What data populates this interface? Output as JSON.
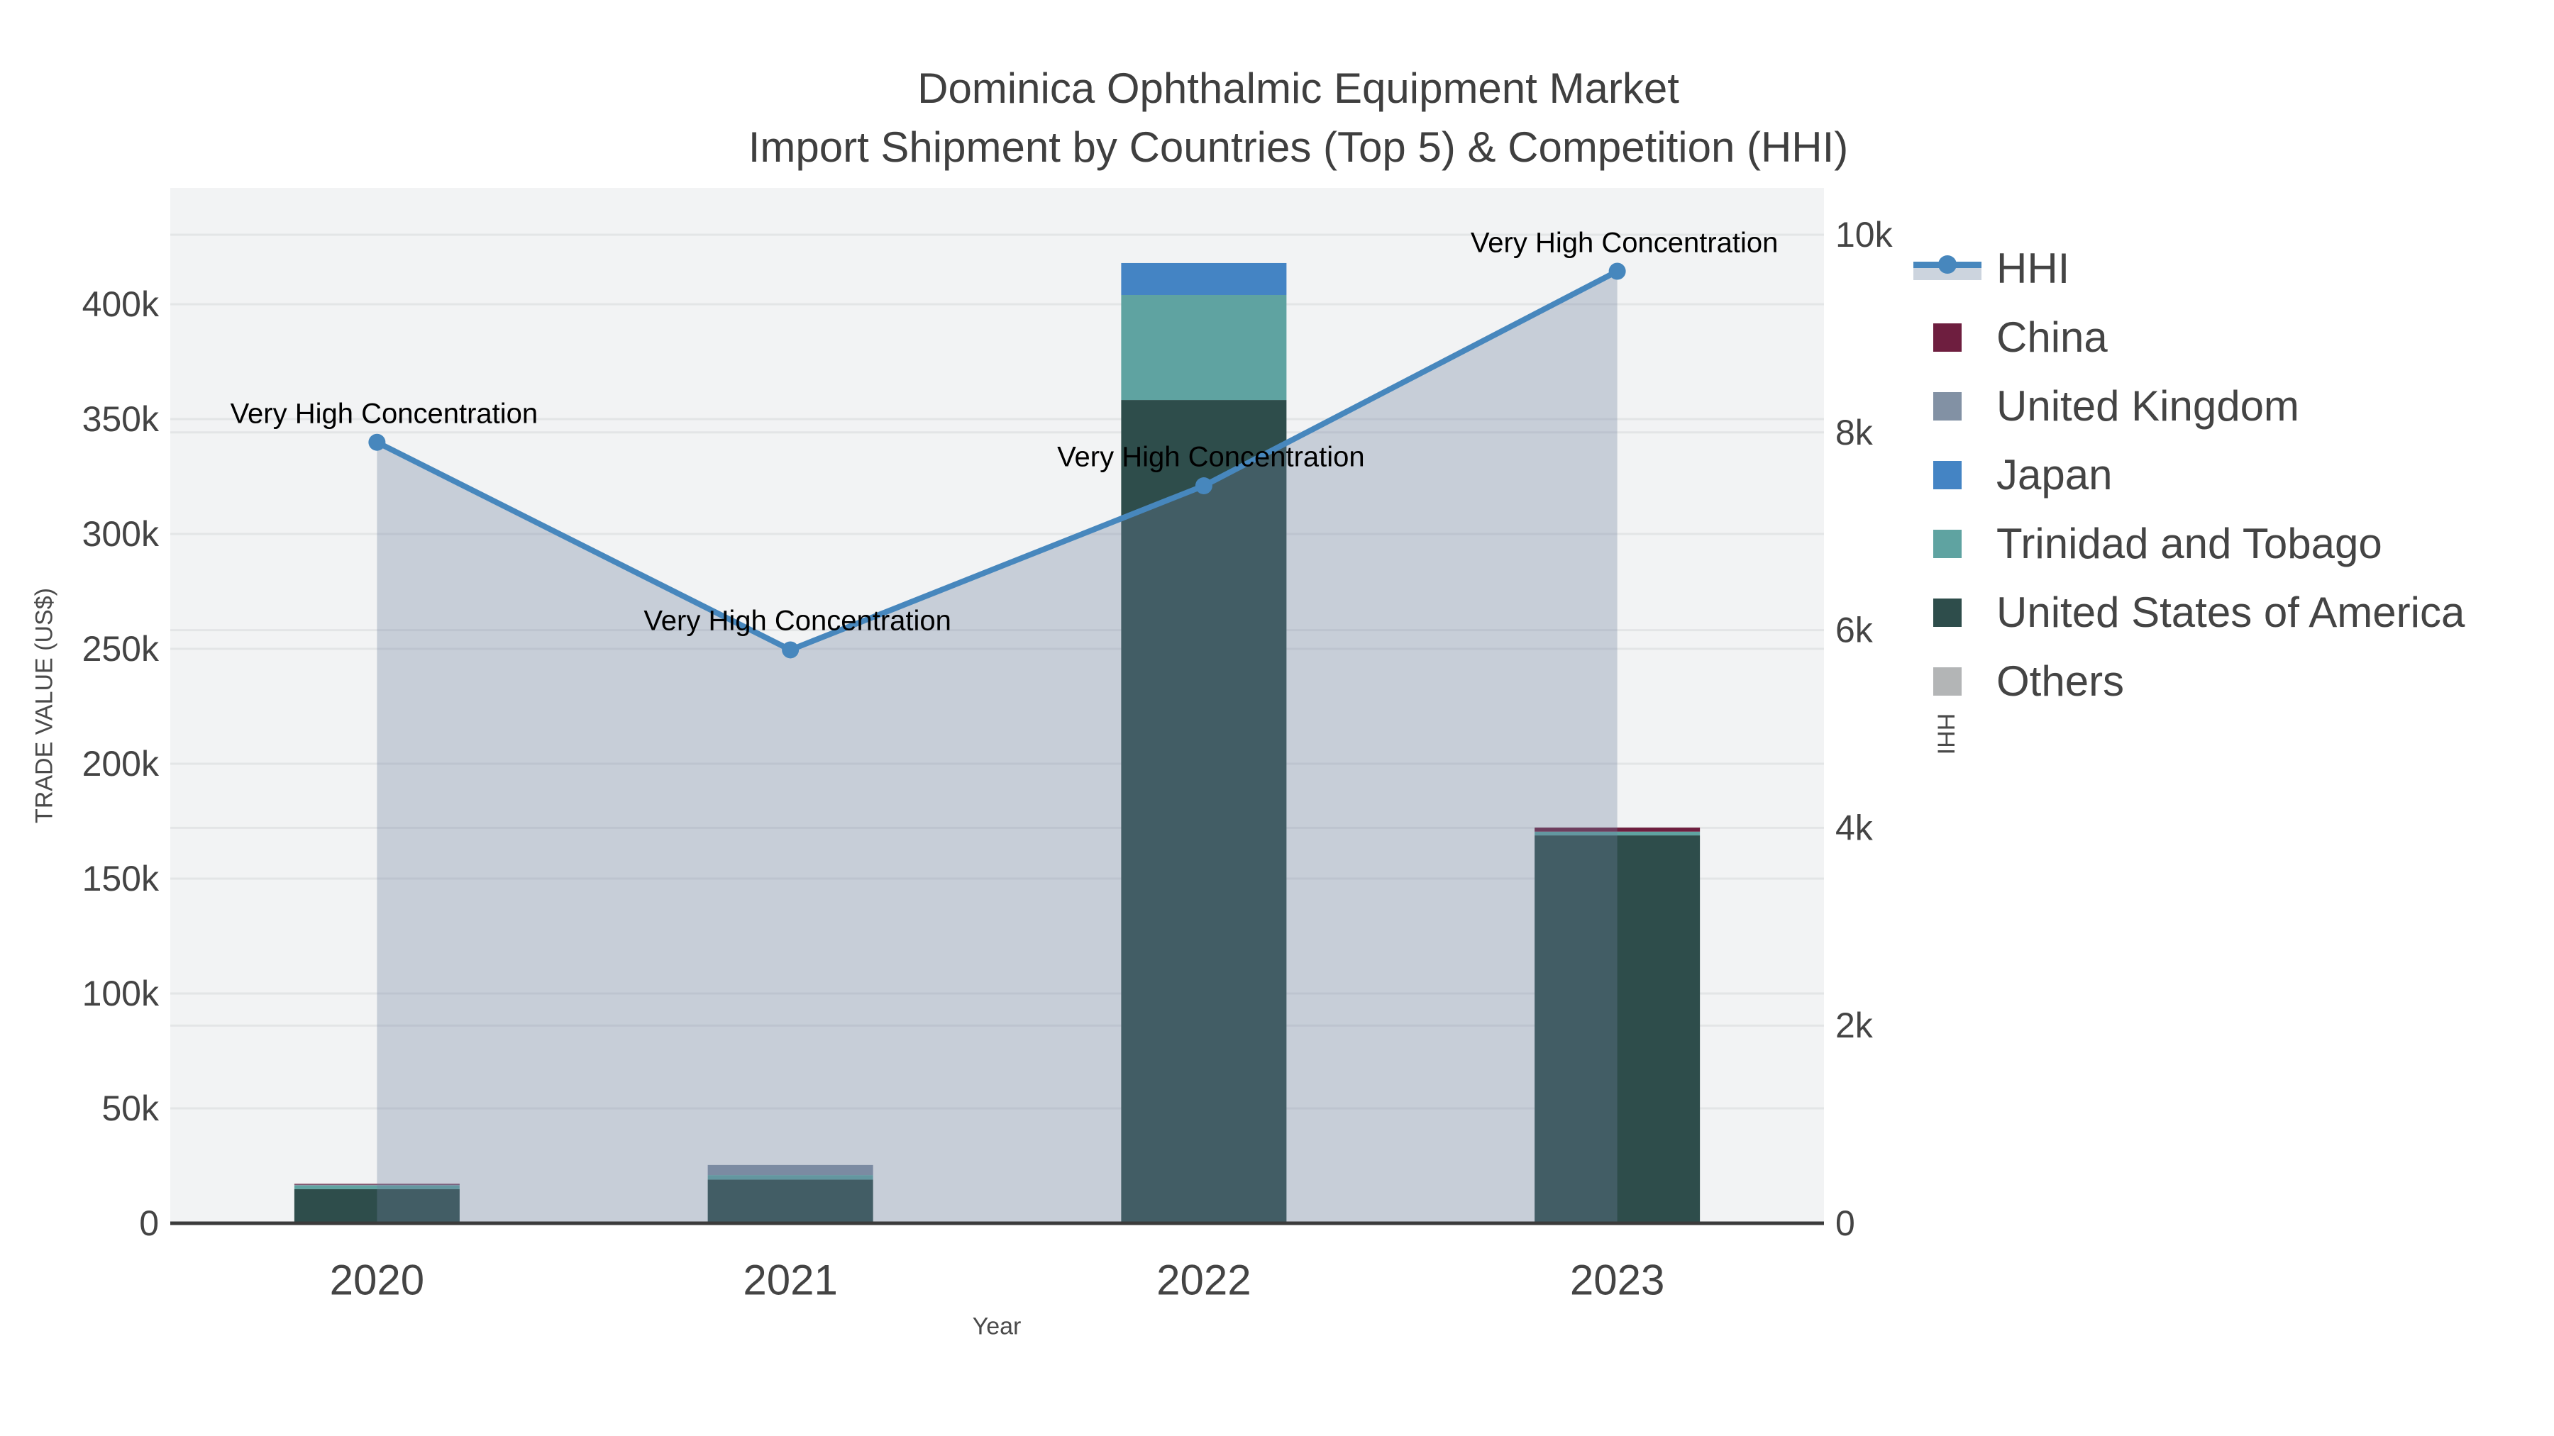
{
  "title": {
    "line1": "Dominica Ophthalmic Equipment Market",
    "line2": "Import Shipment by Countries (Top 5) & Competition (HHI)"
  },
  "axes": {
    "x": {
      "title": "Year",
      "tick_labels": [
        "2020",
        "2021",
        "2022",
        "2023"
      ]
    },
    "y_left": {
      "title": "TRADE VALUE (US$)",
      "range": [
        0,
        450600
      ],
      "ticks": [
        {
          "value": 0,
          "label": "0"
        },
        {
          "value": 50000,
          "label": "50k"
        },
        {
          "value": 100000,
          "label": "100k"
        },
        {
          "value": 150000,
          "label": "150k"
        },
        {
          "value": 200000,
          "label": "200k"
        },
        {
          "value": 250000,
          "label": "250k"
        },
        {
          "value": 300000,
          "label": "300k"
        },
        {
          "value": 350000,
          "label": "350k"
        },
        {
          "value": 400000,
          "label": "400k"
        }
      ]
    },
    "y_right": {
      "title": "HHI",
      "range": [
        0,
        10473
      ],
      "ticks": [
        {
          "value": 0,
          "label": "0"
        },
        {
          "value": 2000,
          "label": "2k"
        },
        {
          "value": 4000,
          "label": "4k"
        },
        {
          "value": 6000,
          "label": "6k"
        },
        {
          "value": 8000,
          "label": "8k"
        },
        {
          "value": 10000,
          "label": "10k"
        }
      ]
    }
  },
  "legend": {
    "items": [
      {
        "id": "hhi",
        "label": "HHI",
        "type": "line",
        "color": "#4787bd"
      },
      {
        "id": "china",
        "label": "China",
        "type": "square",
        "color": "#6e1e3f"
      },
      {
        "id": "united-kingdom",
        "label": "United Kingdom",
        "type": "square",
        "color": "#8291a4"
      },
      {
        "id": "japan",
        "label": "Japan",
        "type": "square",
        "color": "#4484c4"
      },
      {
        "id": "trinidad-and-tobago",
        "label": "Trinidad and Tobago",
        "type": "square",
        "color": "#5fa3a1"
      },
      {
        "id": "united-states-of-america",
        "label": "United States of America",
        "type": "square",
        "color": "#2e4d4b"
      },
      {
        "id": "others",
        "label": "Others",
        "type": "square",
        "color": "#b3b5b6"
      }
    ]
  },
  "chart_data": {
    "type": "bar",
    "subtype": "stacked-bars-with-line",
    "title": "Dominica Ophthalmic Equipment Market — Import Shipment by Countries (Top 5) & Competition (HHI)",
    "categories": [
      "2020",
      "2021",
      "2022",
      "2023"
    ],
    "bar_value_unit": "US$",
    "series": [
      {
        "name": "United States of America",
        "color": "#2e4d4b",
        "values": [
          14900,
          19000,
          358300,
          168800
        ]
      },
      {
        "name": "Trinidad and Tobago",
        "color": "#5fa3a1",
        "values": [
          1550,
          1950,
          45700,
          1650
        ]
      },
      {
        "name": "Japan",
        "color": "#4484c4",
        "values": [
          0,
          0,
          13900,
          0
        ]
      },
      {
        "name": "United Kingdom",
        "color": "#8291a4",
        "values": [
          350,
          4400,
          0,
          0
        ]
      },
      {
        "name": "China",
        "color": "#6e1e3f",
        "values": [
          350,
          0,
          0,
          1750
        ]
      },
      {
        "name": "Others",
        "color": "#b3b5b6",
        "values": [
          0,
          0,
          0,
          0
        ]
      }
    ],
    "bar_totals": [
      17150,
      25350,
      417900,
      172200
    ],
    "line_series": {
      "name": "HHI",
      "axis": "right",
      "values": [
        7900,
        5800,
        7460,
        9630
      ],
      "color": "#4787bd",
      "area_fill": "rgba(108,126,158,0.32)"
    },
    "annotations": [
      {
        "category": "2020",
        "text": "Very High Concentration"
      },
      {
        "category": "2021",
        "text": "Very High Concentration"
      },
      {
        "category": "2022",
        "text": "Very High Concentration"
      },
      {
        "category": "2023",
        "text": "Very High Concentration"
      }
    ],
    "xlabel": "Year",
    "ylabel_left": "TRADE VALUE (US$)",
    "ylabel_right": "HHI",
    "grid": true,
    "legend_position": "right"
  },
  "colors": {
    "plot_background": "#f2f3f4",
    "gridline": "#e3e5e6",
    "axis_line": "#3b3b3b",
    "tick_text": "#444444",
    "title_text": "#3f3f3f",
    "annotation_text": "#000000"
  }
}
